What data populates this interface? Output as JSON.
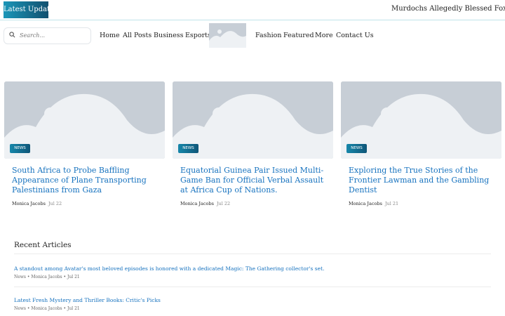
{
  "topbar": {
    "latest_label": "Latest  Update",
    "ticker_text": "Murdochs Allegedly Blessed Fox News :"
  },
  "search": {
    "placeholder": "Search..."
  },
  "nav": {
    "left": [
      "Home",
      "All Posts",
      "Business",
      "Esports"
    ],
    "right": [
      "Fashion",
      "Featured",
      "More",
      "Contact Us"
    ]
  },
  "cards": [
    {
      "badge": "NEWS",
      "title": "South Africa to Probe Baffling Appearance of Plane Transporting Palestinians from Gaza",
      "author": "Monica Jacobs",
      "date": "Jul 22"
    },
    {
      "badge": "NEWS",
      "title": "Equatorial Guinea Pair Issued Multi-Game Ban for Official Verbal Assault at Africa Cup of Nations.",
      "author": "Monica Jacobs",
      "date": "Jul 22"
    },
    {
      "badge": "NEWS",
      "title": "Exploring the True Stories of the Frontier Lawman and the Gambling Dentist",
      "author": "Monica Jacobs",
      "date": "Jul 21"
    }
  ],
  "recent": {
    "heading": "Recent Articles",
    "items": [
      {
        "title": "A standout among Avatar's most beloved episodes is honored with a dedicated Magic: The Gathering collector's set.",
        "meta": "News • Monica Jacobs • Jul 21"
      },
      {
        "title": "Latest Fresh Mystery and Thriller Books: Critic's Picks",
        "meta": "News • Monica Jacobs • Jul 21"
      }
    ]
  },
  "colors": {
    "accent_link": "#1873bf",
    "badge_gradient_start": "#1b96b8",
    "badge_gradient_end": "#11506f",
    "placeholder_bg": "#c7ced6"
  },
  "icons": {
    "search": "search-icon",
    "logo": "image-placeholder-icon"
  }
}
